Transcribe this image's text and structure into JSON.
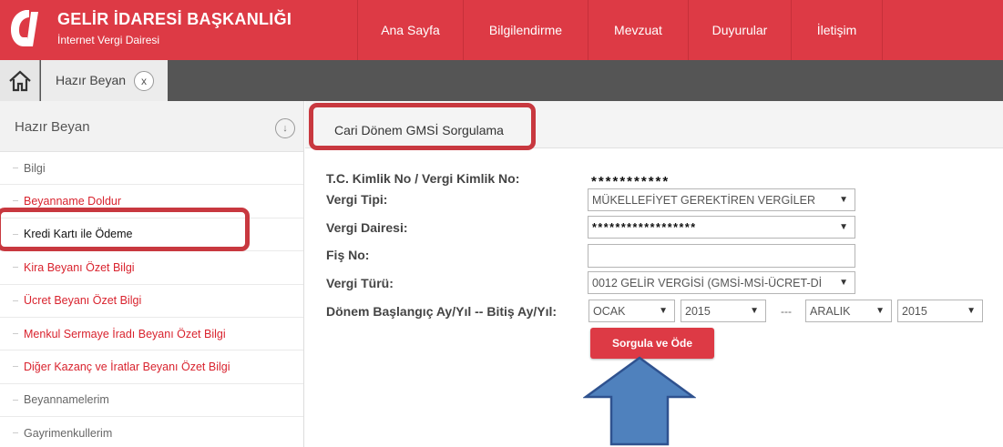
{
  "header": {
    "title": "GELİR İDARESİ BAŞKANLIĞI",
    "subtitle": "İnternet Vergi Dairesi",
    "nav": [
      "Ana Sayfa",
      "Bilgilendirme",
      "Mevzuat",
      "Duyurular",
      "İletişim"
    ]
  },
  "tabs": {
    "active_label": "Hazır Beyan",
    "close_label": "x"
  },
  "sidebar": {
    "heading": "Hazır Beyan",
    "collapse_icon": "↓",
    "items": [
      {
        "label": "Bilgi"
      },
      {
        "label": "Beyanname Doldur"
      },
      {
        "label": "Kredi Kartı ile Ödeme"
      },
      {
        "label": "Kira Beyanı Özet Bilgi"
      },
      {
        "label": "Ücret Beyanı Özet Bilgi"
      },
      {
        "label": "Menkul Sermaye İradı Beyanı Özet Bilgi"
      },
      {
        "label": "Diğer Kazanç ve İratlar Beyanı Özet Bilgi"
      },
      {
        "label": "Beyannamelerim"
      },
      {
        "label": "Gayrimenkullerim"
      }
    ]
  },
  "form": {
    "page_title": "Cari Dönem GMSİ Sorgulama",
    "tc_label": "T.C. Kimlik No / Vergi Kimlik No:",
    "tc_value": "***********",
    "vergi_tipi_label": "Vergi Tipi:",
    "vergi_tipi_value": "MÜKELLEFİYET GEREKTİREN VERGİLER",
    "vergi_dairesi_label": "Vergi Dairesi:",
    "vergi_dairesi_value": "******************",
    "fis_no_label": "Fiş No:",
    "fis_no_value": "",
    "vergi_turu_label": "Vergi Türü:",
    "vergi_turu_value": "0012 GELİR VERGİSİ (GMSİ-MSİ-ÜCRET-Dİ",
    "donem_label": "Dönem Başlangıç Ay/Yıl -- Bitiş Ay/Yıl:",
    "start_month": "OCAK",
    "start_year": "2015",
    "separator": "---",
    "end_month": "ARALIK",
    "end_year": "2015",
    "submit_label": "Sorgula ve Öde",
    "dropdown_arrow": "▼"
  },
  "colors": {
    "brand_red": "#dd3a45",
    "highlight_border": "#c8383f",
    "arrow_fill": "#4f81bd",
    "tab_bar": "#555555"
  }
}
